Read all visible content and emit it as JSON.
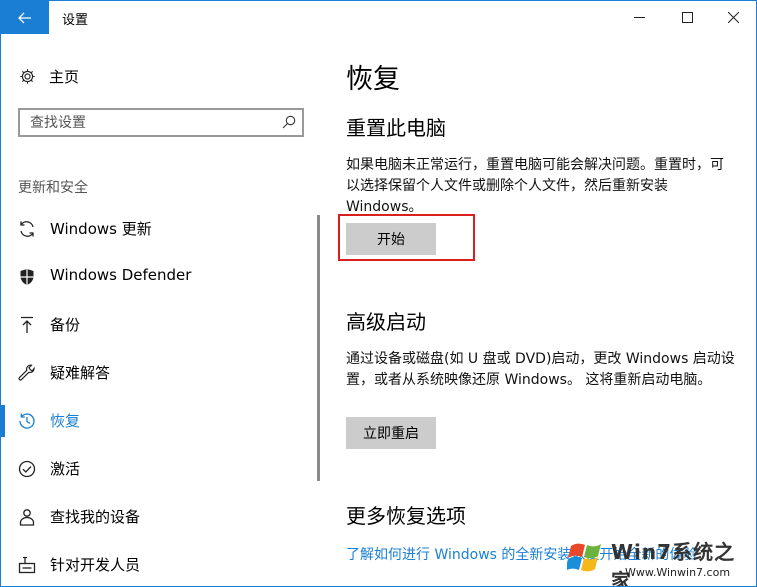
{
  "window": {
    "title": "设置",
    "accent": "#1a7fd4"
  },
  "sidebar": {
    "home_label": "主页",
    "search_placeholder": "查找设置",
    "section_label": "更新和安全",
    "items": [
      {
        "label": "Windows 更新",
        "icon": "sync-icon"
      },
      {
        "label": "Windows Defender",
        "icon": "shield-icon"
      },
      {
        "label": "备份",
        "icon": "backup-arrow-icon"
      },
      {
        "label": "疑难解答",
        "icon": "wrench-icon"
      },
      {
        "label": "恢复",
        "icon": "history-icon",
        "active": true
      },
      {
        "label": "激活",
        "icon": "check-circle-icon"
      },
      {
        "label": "查找我的设备",
        "icon": "person-location-icon"
      },
      {
        "label": "针对开发人员",
        "icon": "developer-icon"
      }
    ]
  },
  "main": {
    "title": "恢复",
    "reset": {
      "heading": "重置此电脑",
      "description": "如果电脑未正常运行，重置电脑可能会解决问题。重置时，可以选择保留个人文件或删除个人文件，然后重新安装 Windows。",
      "button": "开始"
    },
    "advanced": {
      "heading": "高级启动",
      "description": "通过设备或磁盘(如 U 盘或 DVD)启动，更改 Windows 启动设置，或者从系统映像还原 Windows。 这将重新启动电脑。",
      "button": "立即重启"
    },
    "more": {
      "heading": "更多恢复选项",
      "link": "了解如何进行 Windows 的全新安装以便开始全新的体验"
    }
  },
  "watermark": {
    "text": "Win7系统之家",
    "url": "Www.Winwin7.com"
  }
}
